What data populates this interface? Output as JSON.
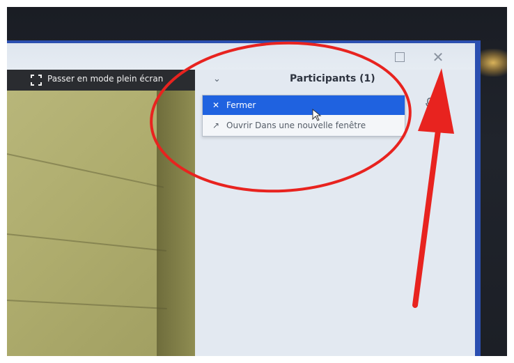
{
  "window": {
    "maximize_icon": "maximize-icon",
    "close_icon": "close-icon",
    "close_glyph": "✕"
  },
  "video": {
    "fullscreen_label": "Passer en mode plein écran",
    "fullscreen_icon": "fullscreen-icon"
  },
  "participants": {
    "title": "Participants (1)",
    "chevron_icon": "chevron-down-icon",
    "mic_icon": "microphone-icon"
  },
  "menu": {
    "items": [
      {
        "label": "Fermer",
        "icon": "close-icon",
        "glyph": "✕",
        "highlighted": true
      },
      {
        "label": "Ouvrir Dans une nouvelle fenêtre",
        "icon": "external-arrow-icon",
        "glyph": "↗",
        "highlighted": false
      }
    ]
  },
  "colors": {
    "accent_blue": "#1f62e0",
    "bezel_blue": "#2b4fb0",
    "annotation_red": "#e8231f"
  }
}
